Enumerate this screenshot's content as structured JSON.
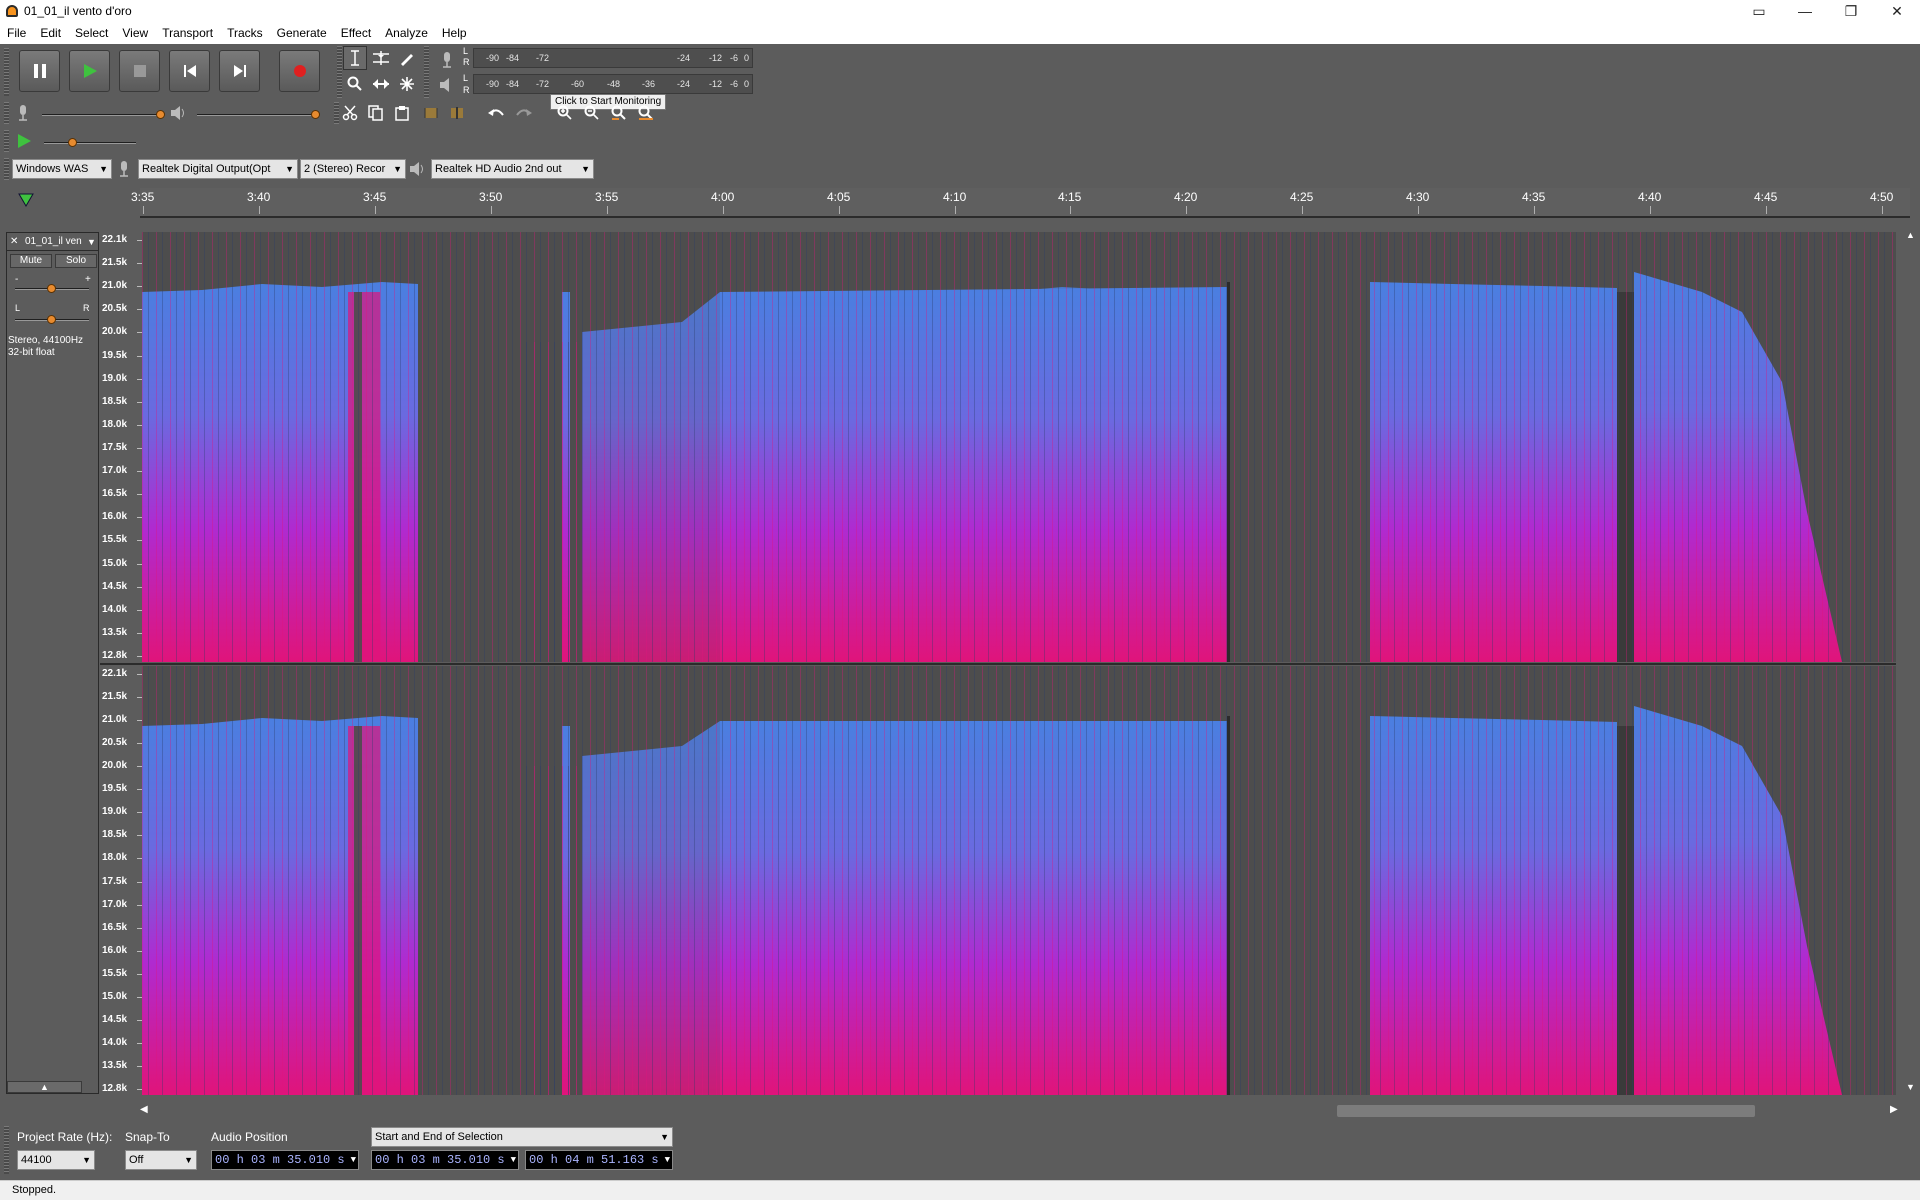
{
  "window": {
    "title": "01_01_il vento d'oro"
  },
  "menu": [
    "File",
    "Edit",
    "Select",
    "View",
    "Transport",
    "Tracks",
    "Generate",
    "Effect",
    "Analyze",
    "Help"
  ],
  "meters": {
    "record_scale": [
      "-90",
      "-84",
      "-72",
      "-24",
      "-12",
      "-6",
      "0"
    ],
    "play_scale": [
      "-90",
      "-84",
      "-72",
      "-60",
      "-48",
      "-36",
      "-24",
      "-12",
      "-6",
      "0"
    ],
    "tooltip": "Click to Start Monitoring",
    "lr": [
      "L",
      "R"
    ]
  },
  "devices": {
    "host": "Windows WAS",
    "recording_device": "Realtek Digital Output(Opt",
    "channels": "2 (Stereo) Recor",
    "playback_device": "Realtek HD Audio 2nd out"
  },
  "ruler": {
    "ticks": [
      "3:35",
      "3:40",
      "3:45",
      "3:50",
      "3:55",
      "4:00",
      "4:05",
      "4:10",
      "4:15",
      "4:20",
      "4:25",
      "4:30",
      "4:35",
      "4:40",
      "4:45",
      "4:50"
    ]
  },
  "track": {
    "name": "01_01_il ven",
    "mute": "Mute",
    "solo": "Solo",
    "gain_minus": "-",
    "gain_plus": "+",
    "pan_left": "L",
    "pan_right": "R",
    "format": "Stereo, 44100Hz",
    "bitdepth": "32-bit float",
    "freq_labels": [
      "22.1k",
      "21.5k",
      "21.0k",
      "20.5k",
      "20.0k",
      "19.5k",
      "19.0k",
      "18.5k",
      "18.0k",
      "17.5k",
      "17.0k",
      "16.5k",
      "16.0k",
      "15.5k",
      "15.0k",
      "14.5k",
      "14.0k",
      "13.5k",
      "12.8k"
    ]
  },
  "bottom": {
    "project_rate_label": "Project Rate (Hz):",
    "project_rate": "44100",
    "snap_label": "Snap-To",
    "snap": "Off",
    "audio_position_label": "Audio Position",
    "audio_position": "00 h 03 m 35.010 s",
    "selection_mode": "Start and End of Selection",
    "sel_start": "00 h 03 m 35.010 s",
    "sel_end": "00 h 04 m 51.163 s"
  },
  "status": "Stopped.",
  "colors": {
    "spectro_hot": "#e0147a",
    "spectro_mid": "#b02ad0",
    "spectro_cool": "#4a7fe0",
    "background": "#5c5c5c"
  }
}
